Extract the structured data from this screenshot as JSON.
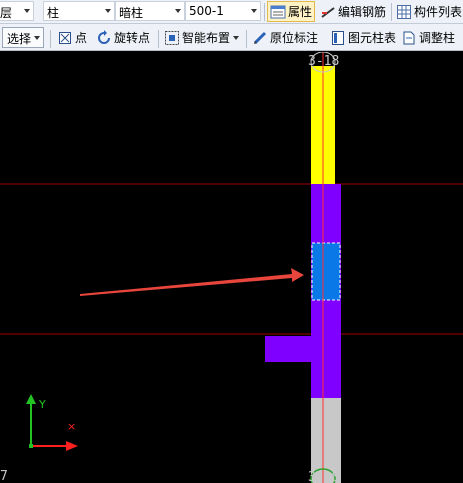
{
  "toolbar_top": {
    "floor_value": "层",
    "category_value": "柱",
    "type_value": "暗柱",
    "element_value": "500-1",
    "properties_label": "属性",
    "edit_rebar_label": "编辑钢筋",
    "component_list_label": "构件列表"
  },
  "toolbar_draw": {
    "select_label": "选择",
    "point_label": "点",
    "rotate_point_label": "旋转点",
    "smart_layout_label": "智能布置",
    "origin_annotation_label": "原位标注",
    "element_column_table_label": "图元柱表",
    "adjust_column_label": "调整柱"
  },
  "canvas": {
    "axis_label_top": "3-18",
    "axis_label_bottom": "3-18",
    "corner_label": "7",
    "y_axis_label": "Y",
    "x_axis_label": "×",
    "colors": {
      "background": "#000000",
      "column_yellow": "#ffff00",
      "column_purple": "#8000ff",
      "column_selected_blue": "#0a78e6",
      "column_grey": "#c8c8c8",
      "grid_line": "#a00000",
      "arrow": "#e8463c",
      "ucs_y": "#22c322",
      "ucs_x": "#ff2020"
    }
  }
}
